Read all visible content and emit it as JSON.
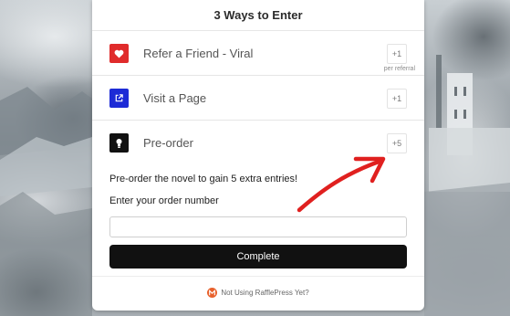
{
  "widget": {
    "title": "3 Ways to Enter"
  },
  "entries": [
    {
      "label": "Refer a Friend - Viral",
      "points": "+1",
      "sub": "per referral",
      "icon": "heart-icon",
      "color": "#e02b2b"
    },
    {
      "label": "Visit a Page",
      "points": "+1",
      "icon": "external-link-icon",
      "color": "#1d2bd6"
    },
    {
      "label": "Pre-order",
      "points": "+5",
      "icon": "lightbulb-icon",
      "color": "#111111"
    }
  ],
  "preorder": {
    "description": "Pre-order the novel to gain 5 extra entries!",
    "input_label": "Enter your order number",
    "input_value": "",
    "button_label": "Complete"
  },
  "footer": {
    "text": "Not Using RafflePress Yet?",
    "icon": "rafflepress-logo-icon",
    "color": "#e8612c"
  },
  "annotation": {
    "color": "#e0201f",
    "icon": "red-arrow-icon"
  }
}
